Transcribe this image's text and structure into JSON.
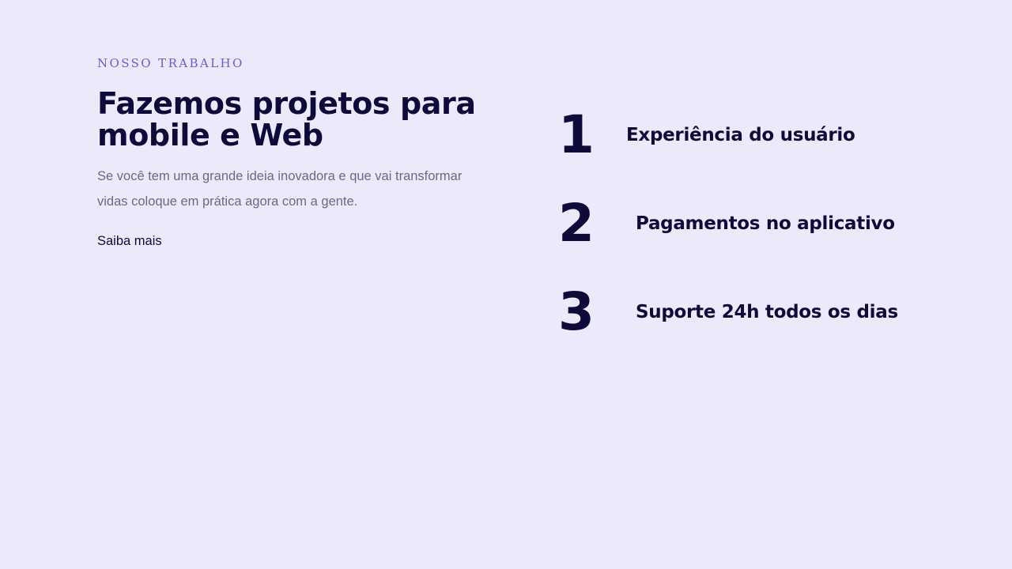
{
  "section": {
    "eyebrow": "NOSSO TRABALHO",
    "headline": "Fazemos projetos para mobile e Web",
    "description": "Se você tem uma grande ideia inovadora e que vai transformar vidas coloque em prática agora com a gente.",
    "link_label": "Saiba mais"
  },
  "features": [
    {
      "number": "1",
      "label": "Experiência do usuário"
    },
    {
      "number": "2",
      "label": "Pagamentos no aplicativo"
    },
    {
      "number": "3",
      "label": "Suporte 24h todos os dias"
    }
  ],
  "colors": {
    "background": "#ece9fb",
    "accent": "#6b5bd6",
    "text_dark": "#0e0a3a",
    "text_muted": "#6b6888"
  }
}
